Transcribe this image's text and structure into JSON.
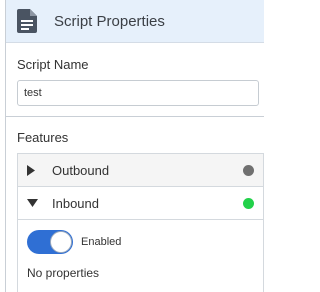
{
  "panel": {
    "title": "Script Properties",
    "icon": "document-icon"
  },
  "script_name": {
    "label": "Script Name",
    "value": "test"
  },
  "features": {
    "label": "Features",
    "items": [
      {
        "name": "Outbound",
        "expanded": false,
        "status_color": "#707070"
      },
      {
        "name": "Inbound",
        "expanded": true,
        "status_color": "#22d14a",
        "toggle_label": "Enabled",
        "toggle_on": true,
        "empty_text": "No properties"
      }
    ]
  },
  "colors": {
    "header_bg": "#e6f0fb",
    "toggle_on": "#2f6fd4"
  }
}
